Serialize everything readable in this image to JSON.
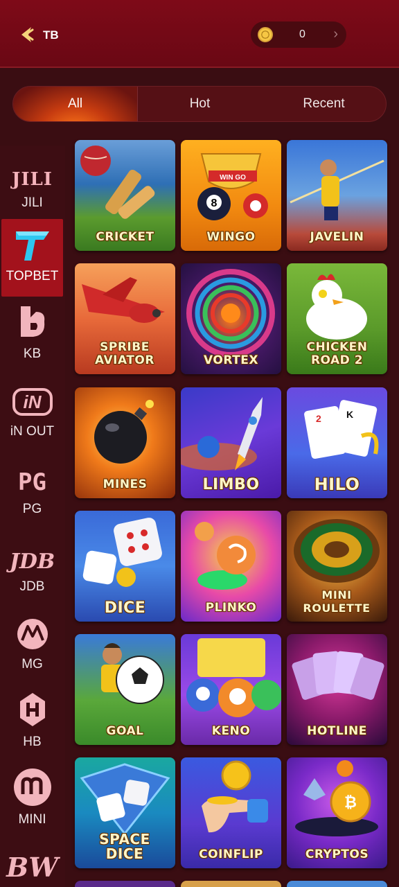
{
  "header": {
    "brand": "TB",
    "balance": "0"
  },
  "tabs": [
    {
      "label": "All",
      "active": true
    },
    {
      "label": "Hot",
      "active": false
    },
    {
      "label": "Recent",
      "active": false
    }
  ],
  "sidebar": {
    "items": [
      {
        "label": "JILI",
        "logo_text": "JILI",
        "icon": "jili-logo-icon"
      },
      {
        "label": "TOPBET",
        "logo_text": "",
        "icon": "topbet-logo-icon",
        "active": true
      },
      {
        "label": "KB",
        "logo_text": "",
        "icon": "kb-logo-icon"
      },
      {
        "label": "iN OUT",
        "logo_text": "iN",
        "icon": "inout-logo-icon"
      },
      {
        "label": "PG",
        "logo_text": "PG",
        "icon": "pg-logo-icon"
      },
      {
        "label": "JDB",
        "logo_text": "JDB",
        "icon": "jdb-logo-icon"
      },
      {
        "label": "MG",
        "logo_text": "",
        "icon": "mg-logo-icon"
      },
      {
        "label": "HB",
        "logo_text": "",
        "icon": "hb-logo-icon"
      },
      {
        "label": "MINI",
        "logo_text": "",
        "icon": "mini-logo-icon"
      },
      {
        "label": "",
        "logo_text": "BW",
        "icon": "bw-logo-icon"
      }
    ]
  },
  "games": [
    {
      "title": "CRICKET"
    },
    {
      "title": "WINGO",
      "badge": "WIN GO"
    },
    {
      "title": "JAVELIN"
    },
    {
      "title": "SPRIBE AVIATOR"
    },
    {
      "title": "VORTEX"
    },
    {
      "title": "CHICKEN ROAD 2"
    },
    {
      "title": "MINES"
    },
    {
      "title": "LIMBO"
    },
    {
      "title": "HILO"
    },
    {
      "title": "DICE"
    },
    {
      "title": "PLINKO"
    },
    {
      "title": "MINI ROULETTE"
    },
    {
      "title": "GOAL"
    },
    {
      "title": "KENO"
    },
    {
      "title": "HOTLINE"
    },
    {
      "title": "SPACE DICE"
    },
    {
      "title": "COINFLIP"
    },
    {
      "title": "CRYPTOS"
    }
  ]
}
